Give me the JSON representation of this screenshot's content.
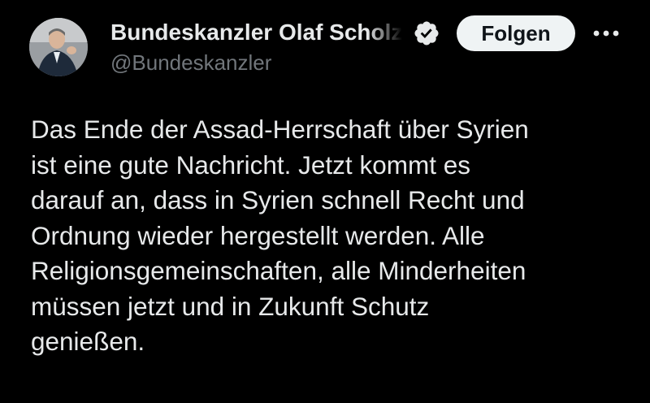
{
  "author": {
    "display_name": "Bundeskanzler Olaf Scholz",
    "handle": "@Bundeskanzler",
    "verified_icon": "verified-badge-icon",
    "avatar_icon": "avatar"
  },
  "actions": {
    "follow_label": "Folgen",
    "more_icon": "more-options-icon"
  },
  "tweet": {
    "lines": [
      "Das Ende der Assad-Herrschaft über Syrien",
      "ist eine gute Nachricht. Jetzt kommt es",
      "darauf an, dass in Syrien schnell Recht und",
      "Ordnung wieder hergestellt werden. Alle",
      "Religionsgemeinschaften, alle Minderheiten",
      "müssen jetzt und in Zukunft Schutz",
      "genießen."
    ]
  },
  "colors": {
    "background": "#000000",
    "text_primary": "#e7e9ea",
    "text_secondary": "#71767b",
    "follow_bg": "#eff3f4",
    "follow_text": "#0f1419",
    "verified": "#e7e9ea"
  }
}
